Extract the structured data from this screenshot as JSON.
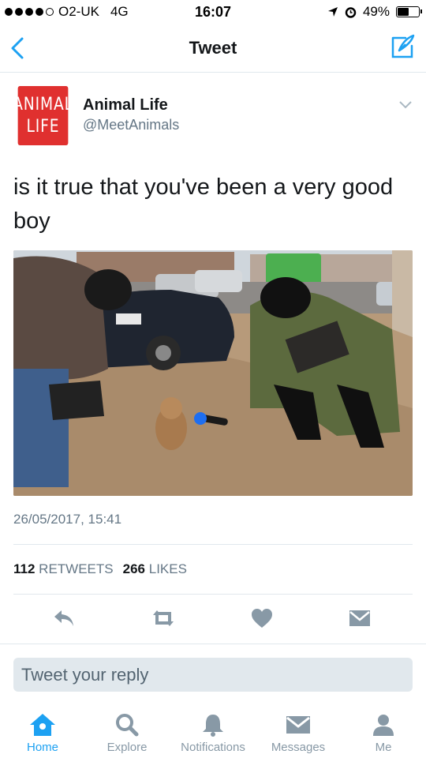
{
  "status_bar": {
    "carrier": "O2-UK",
    "network": "4G",
    "time": "16:07",
    "battery": "49%",
    "battery_level": 0.49
  },
  "nav": {
    "title": "Tweet"
  },
  "tweet": {
    "avatar_line1": "ANIMAL",
    "avatar_line2": "LIFE",
    "name": "Animal Life",
    "handle": "@MeetAnimals",
    "text": "is it true that you've been a very good boy",
    "timestamp": "26/05/2017, 15:41",
    "retweets_count": "112",
    "retweets_label": "RETWEETS",
    "likes_count": "266",
    "likes_label": "LIKES"
  },
  "reply": {
    "placeholder": "Tweet your reply"
  },
  "tabs": [
    {
      "label": "Home",
      "icon": "home-icon",
      "active": true
    },
    {
      "label": "Explore",
      "icon": "search-icon",
      "active": false
    },
    {
      "label": "Notifications",
      "icon": "bell-icon",
      "active": false
    },
    {
      "label": "Messages",
      "icon": "envelope-icon",
      "active": false
    },
    {
      "label": "Me",
      "icon": "person-icon",
      "active": false
    }
  ],
  "colors": {
    "accent": "#1da1f2",
    "brand_avatar": "#e0302f",
    "muted": "#657786",
    "icon_gray": "#8899a6"
  }
}
